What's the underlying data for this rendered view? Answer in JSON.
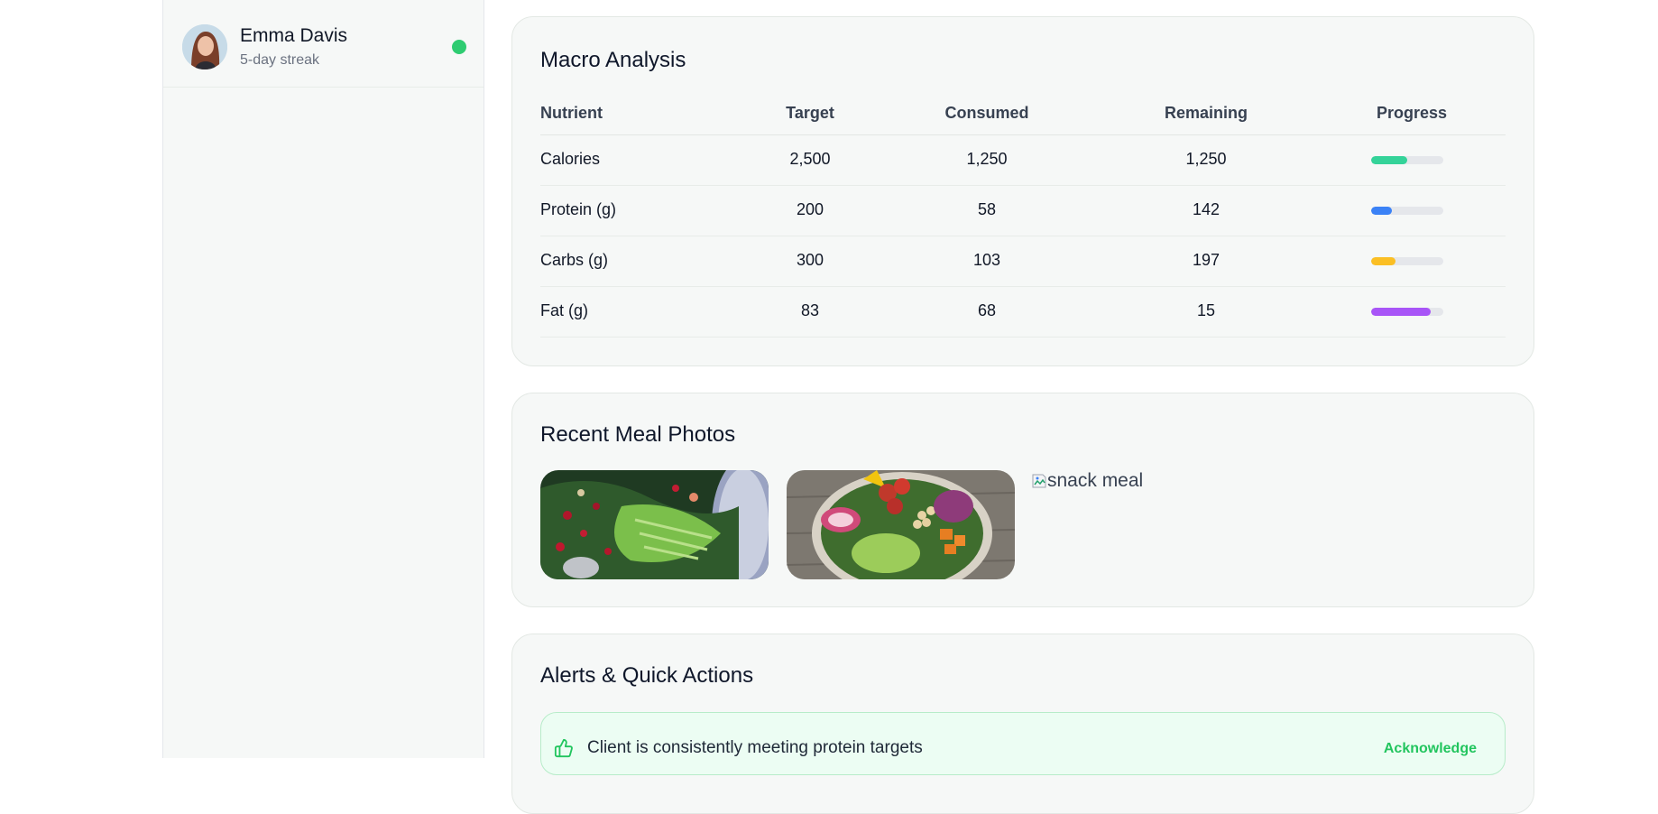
{
  "client": {
    "name": "Emma Davis",
    "streak": "5-day streak",
    "status_color": "#2ecc71"
  },
  "macro": {
    "title": "Macro Analysis",
    "headers": [
      "Nutrient",
      "Target",
      "Consumed",
      "Remaining",
      "Progress"
    ],
    "rows": [
      {
        "nutrient": "Calories",
        "target": "2,500",
        "consumed": "1,250",
        "remaining": "1,250",
        "progress": 0.5,
        "color": "#34d399"
      },
      {
        "nutrient": "Protein (g)",
        "target": "200",
        "consumed": "58",
        "remaining": "142",
        "progress": 0.29,
        "color": "#3b82f6"
      },
      {
        "nutrient": "Carbs (g)",
        "target": "300",
        "consumed": "103",
        "remaining": "197",
        "progress": 0.34,
        "color": "#fbbf24"
      },
      {
        "nutrient": "Fat (g)",
        "target": "83",
        "consumed": "68",
        "remaining": "15",
        "progress": 0.82,
        "color": "#a855f7"
      }
    ]
  },
  "photos": {
    "title": "Recent Meal Photos",
    "items": [
      "salad-photo",
      "buddha-bowl-photo"
    ],
    "broken_alt": "snack meal"
  },
  "alerts": {
    "title": "Alerts & Quick Actions",
    "items": [
      {
        "text": "Client is consistently meeting protein targets",
        "action": "Acknowledge",
        "icon": "thumbs-up-icon"
      }
    ]
  }
}
